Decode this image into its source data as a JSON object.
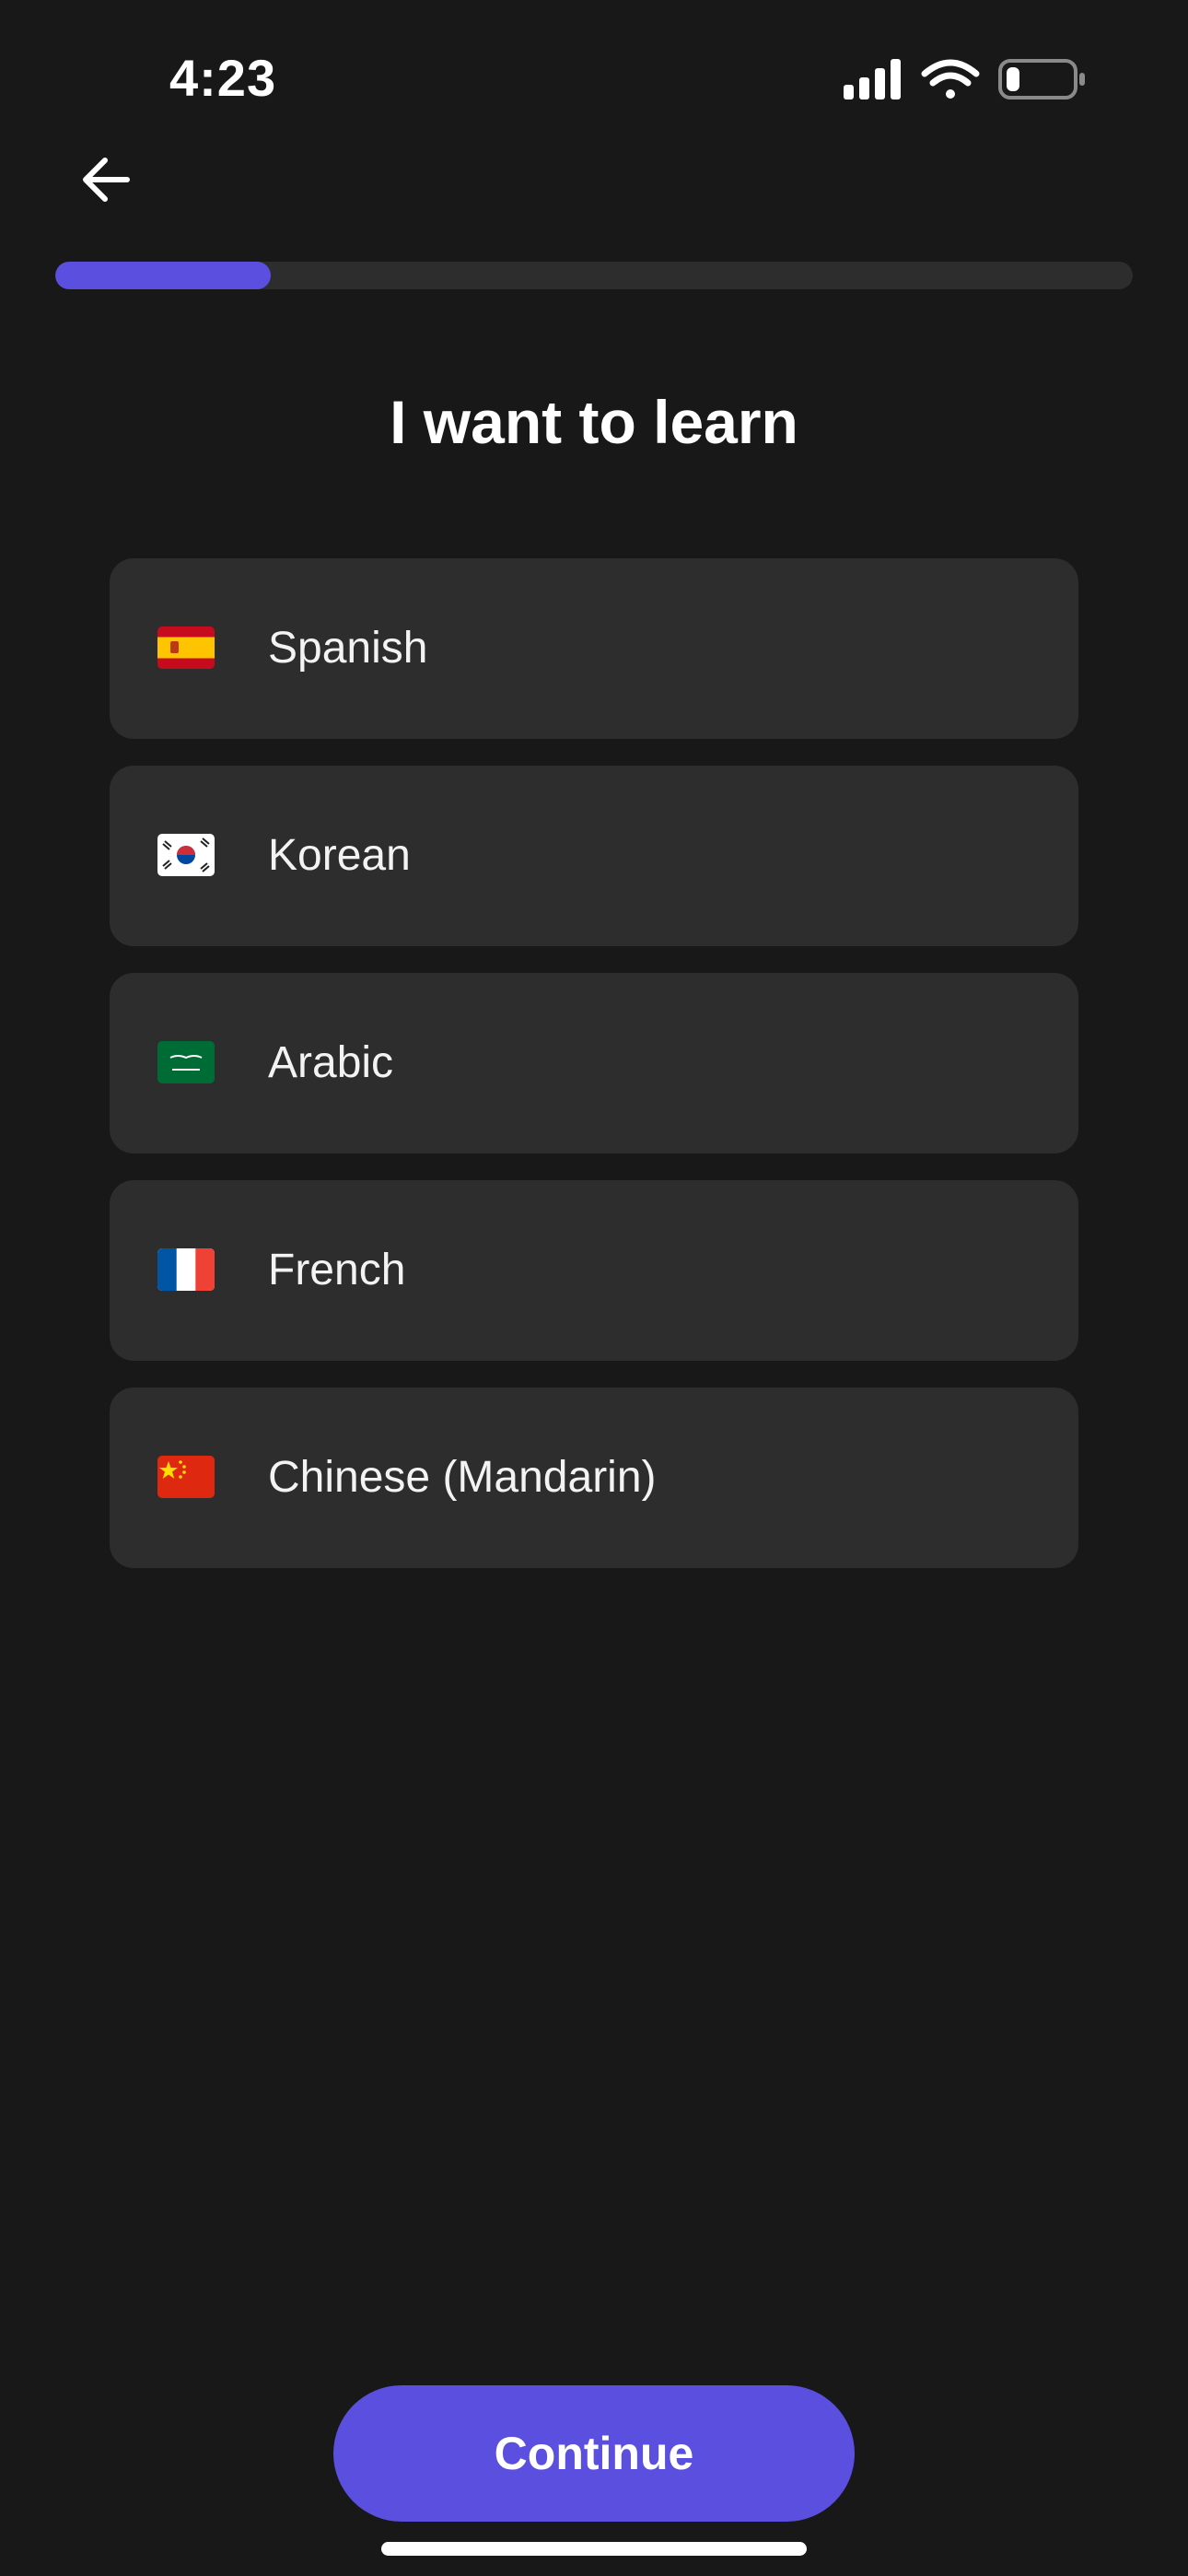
{
  "status_bar": {
    "time": "4:23",
    "icons": [
      "cellular-signal-icon",
      "wifi-icon",
      "battery-icon"
    ],
    "battery_level": 0.2
  },
  "header": {
    "back_icon": "arrow-left-icon"
  },
  "progress": {
    "fraction": 0.2,
    "color": "#5b4fdf"
  },
  "title": "I want to learn",
  "languages": [
    {
      "label": "Spanish",
      "flag": "spain-flag-icon"
    },
    {
      "label": "Korean",
      "flag": "south-korea-flag-icon"
    },
    {
      "label": "Arabic",
      "flag": "saudi-arabia-flag-icon"
    },
    {
      "label": "French",
      "flag": "france-flag-icon"
    },
    {
      "label": "Chinese (Mandarin)",
      "flag": "china-flag-icon"
    }
  ],
  "continue_button": {
    "label": "Continue"
  },
  "colors": {
    "background": "#181818",
    "card": "#2d2d2d",
    "accent": "#5b4fdf",
    "text": "#ffffff"
  }
}
